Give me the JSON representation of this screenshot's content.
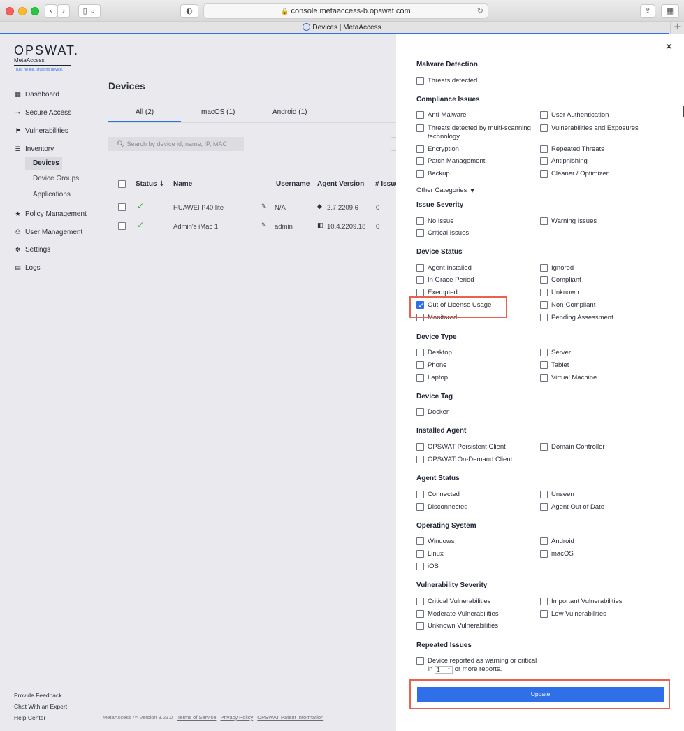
{
  "browser": {
    "url": "console.metaaccess-b.opswat.com",
    "tab_title": "Devices | MetaAccess"
  },
  "brand": {
    "logo": "OPSWAT.",
    "product": "MetaAccess",
    "tagline": "Trust no file. Trust no device.",
    "accent_color": "#2f6fe8",
    "highlight_color": "#e8624e"
  },
  "sidebar": {
    "items": [
      {
        "label": "Dashboard",
        "icon": "grid-icon"
      },
      {
        "label": "Secure Access",
        "icon": "key-icon"
      },
      {
        "label": "Vulnerabilities",
        "icon": "flag-icon"
      },
      {
        "label": "Inventory",
        "icon": "list-icon"
      },
      {
        "label": "Devices"
      },
      {
        "label": "Device Groups"
      },
      {
        "label": "Applications"
      },
      {
        "label": "Policy Management",
        "icon": "star-icon"
      },
      {
        "label": "User Management",
        "icon": "users-icon"
      },
      {
        "label": "Settings",
        "icon": "gear-icon"
      },
      {
        "label": "Logs",
        "icon": "clipboard-icon"
      }
    ],
    "footer": [
      "Provide Feedback",
      "Chat With an Expert",
      "Help Center"
    ]
  },
  "main": {
    "title": "Devices",
    "tabs": [
      "All (2)",
      "macOS (1)",
      "Android (1)"
    ],
    "search_placeholder": "Search by device id, name, IP, MAC",
    "columns": [
      "Status",
      "Name",
      "Username",
      "Agent Version",
      "# Issue"
    ],
    "rows": [
      {
        "name": "HUAWEI P40 lite",
        "username": "N/A",
        "agent_version": "2.7.2209.6",
        "issues": "0"
      },
      {
        "name": "Admin's iMac 1",
        "username": "admin",
        "agent_version": "10.4.2209.18",
        "issues": "0"
      }
    ],
    "footer": {
      "version": "MetaAccess ™  Version 3.23.0",
      "links": [
        "Terms of Service",
        "Privacy Policy",
        "OPSWAT Patent Information"
      ]
    }
  },
  "filters": {
    "malware": {
      "title": "Malware Detection",
      "options": [
        "Threats detected"
      ]
    },
    "compliance": {
      "title": "Compliance Issues",
      "options": [
        "Anti-Malware",
        "User Authentication",
        "Threats detected by multi-scanning",
        "technology",
        "Vulnerabilities and Exposures",
        "Encryption",
        "Repeated Threats",
        "Patch Management",
        "Antiphishing",
        "Backup",
        "Cleaner / Optimizer"
      ]
    },
    "other_categories": "Other Categories",
    "severity": {
      "title": "Issue Severity",
      "options": [
        "No Issue",
        "Warning Issues",
        "Critical Issues"
      ]
    },
    "status": {
      "title": "Device Status",
      "options": [
        "Agent Installed",
        "Ignored",
        "In Grace Period",
        "Compliant",
        "Exempted",
        "Unknown",
        "Out of License Usage",
        "Non-Compliant",
        "Monitored",
        "Pending Assessment"
      ]
    },
    "type": {
      "title": "Device Type",
      "options": [
        "Desktop",
        "Server",
        "Phone",
        "Tablet",
        "Laptop",
        "Virtual Machine"
      ]
    },
    "tag": {
      "title": "Device Tag",
      "options": [
        "Docker"
      ]
    },
    "agent": {
      "title": "Installed Agent",
      "options": [
        "OPSWAT Persistent Client",
        "Domain Controller",
        "OPSWAT On-Demand Client"
      ]
    },
    "agent_status": {
      "title": "Agent Status",
      "options": [
        "Connected",
        "Unseen",
        "Disconnected",
        "Agent Out of Date"
      ]
    },
    "os": {
      "title": "Operating System",
      "options": [
        "Windows",
        "Android",
        "Linux",
        "macOS",
        "iOS"
      ]
    },
    "vuln": {
      "title": "Vulnerability Severity",
      "options": [
        "Critical Vulnerabilities",
        "Important Vulnerabilities",
        "Moderate Vulnerabilities",
        "Low Vulnerabilities",
        "Unknown Vulnerabilities"
      ]
    },
    "repeated": {
      "title": "Repeated Issues",
      "line1": "Device reported as warning or critical",
      "in": "in",
      "value": "1",
      "suffix": "or more reports."
    },
    "update_label": "Update"
  }
}
